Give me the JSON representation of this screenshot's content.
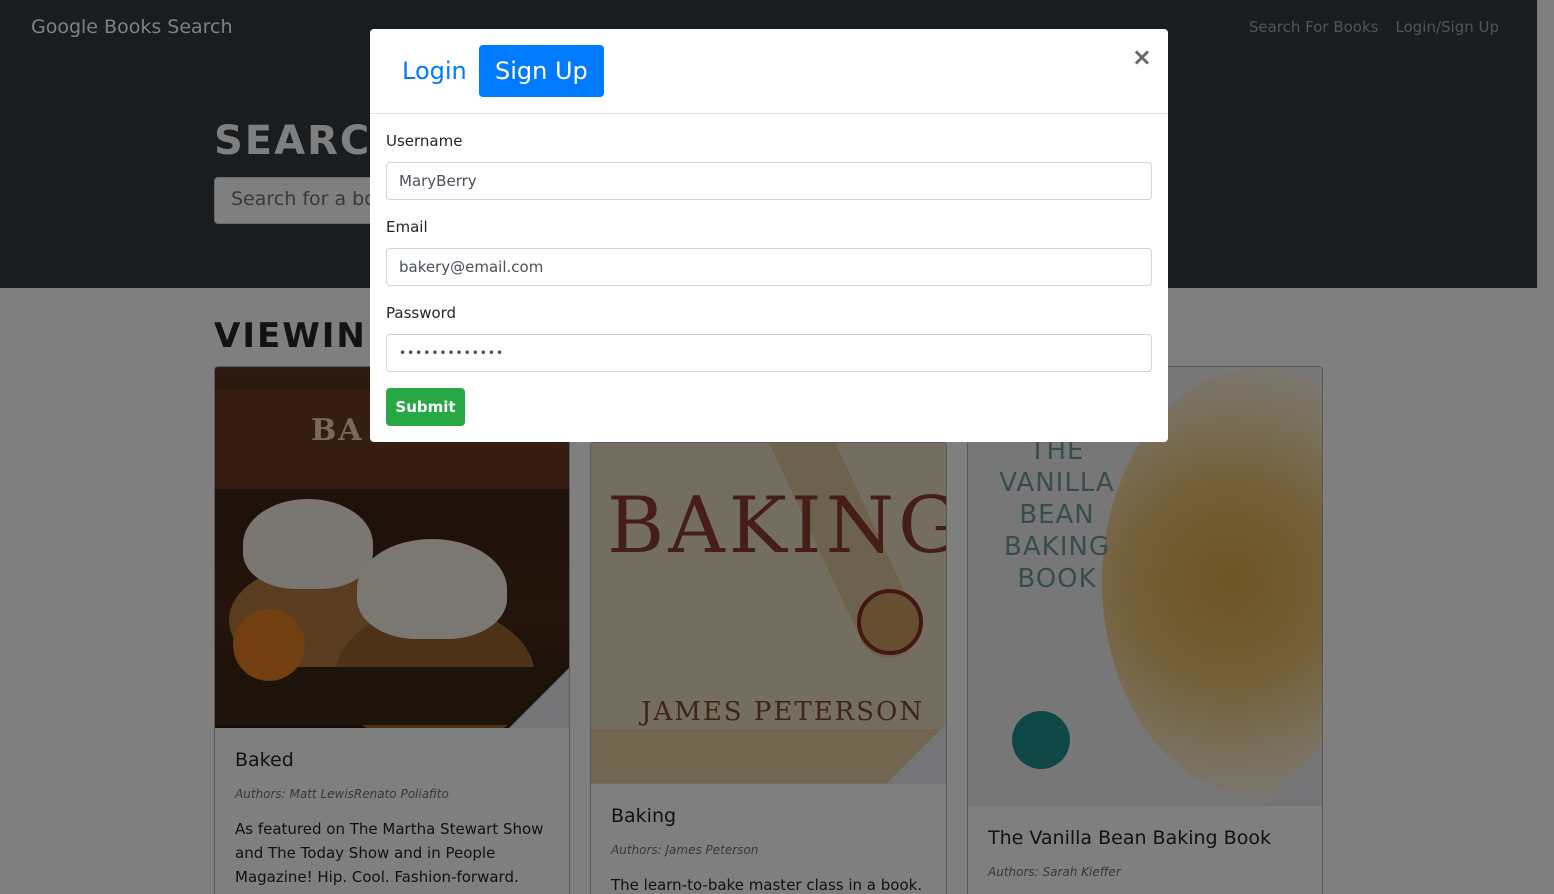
{
  "navbar": {
    "brand": "Google Books Search",
    "links": [
      "Search For Books",
      "Login/Sign Up"
    ]
  },
  "hero": {
    "title": "SEARC",
    "search_placeholder": "Search for a bo"
  },
  "results": {
    "heading": "VIEWIN",
    "books": [
      {
        "cover_text": "BA",
        "title": "Baked",
        "authors": "Authors: Matt LewisRenato Poliafito",
        "description": "As featured on The Martha Stewart Show and The Today Show and in People Magazine! Hip. Cool. Fashion-forward."
      },
      {
        "cover_text": "BAKING",
        "cover_author": "JAMES PETERSON",
        "title": "Baking",
        "authors": "Authors: James Peterson",
        "description": "The learn-to-bake master class in a book."
      },
      {
        "cover_text": "THE VANILLA BEAN BAKING BOOK",
        "title": "The Vanilla Bean Baking Book",
        "authors": "Authors: Sarah Kieffer"
      }
    ]
  },
  "modal": {
    "tabs": [
      "Login",
      "Sign Up"
    ],
    "active_tab": "Sign Up",
    "close_symbol": "×",
    "fields": {
      "username": {
        "label": "Username",
        "value": "MaryBerry"
      },
      "email": {
        "label": "Email",
        "value": "bakery@email.com"
      },
      "password": {
        "label": "Password",
        "value": "•••••••••••••"
      }
    },
    "submit_label": "Submit"
  },
  "colors": {
    "navbar_bg": "#343a40",
    "primary": "#007bff",
    "success": "#28a745"
  }
}
